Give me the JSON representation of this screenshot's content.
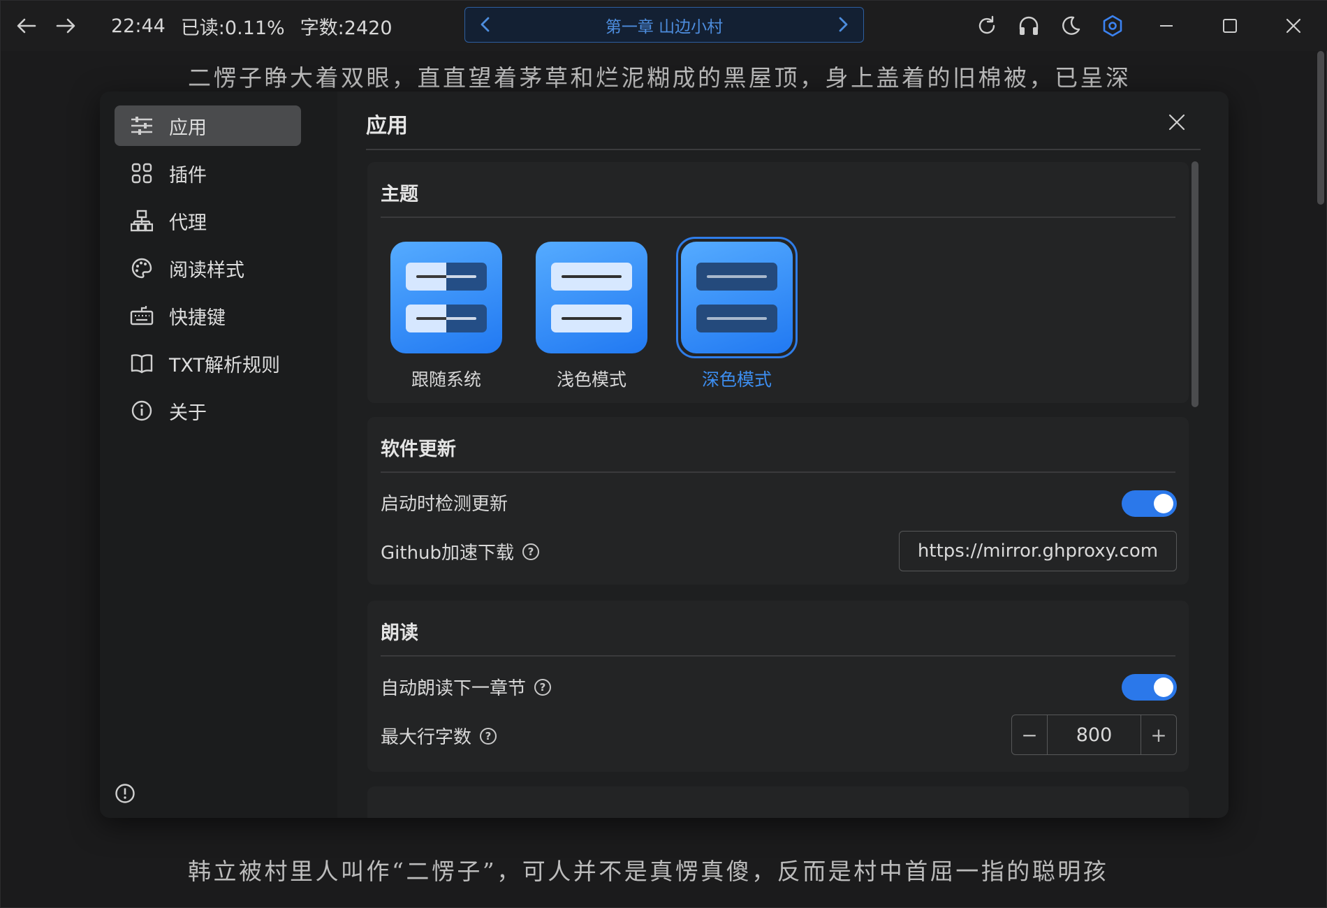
{
  "titlebar": {
    "time": "22:44",
    "read_progress": "已读:0.11%",
    "word_count": "字数:2420",
    "chapter_title": "第一章 山边小村"
  },
  "reader": {
    "line1": "二愣子睁大着双眼，直直望着茅草和烂泥糊成的黑屋顶，身上盖着的旧棉被，已呈深",
    "line2": "韩立被村里人叫作“二愣子”，可人并不是真愣真傻，反而是村中首屈一指的聪明孩"
  },
  "sidebar": {
    "items": [
      {
        "label": "应用",
        "icon": "sliders-icon"
      },
      {
        "label": "插件",
        "icon": "grid-icon"
      },
      {
        "label": "代理",
        "icon": "network-icon"
      },
      {
        "label": "阅读样式",
        "icon": "palette-icon"
      },
      {
        "label": "快捷键",
        "icon": "keyboard-icon"
      },
      {
        "label": "TXT解析规则",
        "icon": "book-icon"
      },
      {
        "label": "关于",
        "icon": "info-icon"
      }
    ],
    "active_index": 0
  },
  "settings": {
    "title": "应用",
    "theme": {
      "heading": "主题",
      "options": [
        "跟随系统",
        "浅色模式",
        "深色模式"
      ],
      "selected": "深色模式"
    },
    "update": {
      "heading": "软件更新",
      "check_on_start_label": "启动时检测更新",
      "check_on_start": true,
      "github_label": "Github加速下载",
      "github_value": "https://mirror.ghproxy.com"
    },
    "read_aloud": {
      "heading": "朗读",
      "auto_next_label": "自动朗读下一章节",
      "auto_next": true,
      "max_chars_label": "最大行字数",
      "max_chars": "800"
    }
  },
  "colors": {
    "accent": "#2b78ea",
    "active_label": "#3d8ef0",
    "chapter_text": "#4d8dde"
  }
}
